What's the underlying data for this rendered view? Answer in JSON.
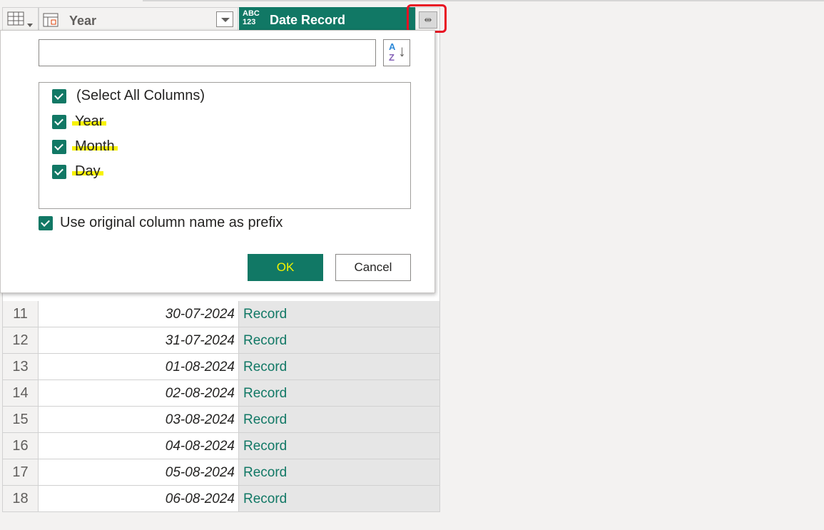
{
  "header": {
    "year_label": "Year",
    "date_type_badge_top": "ABC",
    "date_type_badge_bottom": "123",
    "date_record_label": "Date Record"
  },
  "dialog": {
    "search_value": "",
    "columns": [
      {
        "label": "(Select All Columns)",
        "checked": true
      },
      {
        "label": "Year",
        "checked": true
      },
      {
        "label": "Month",
        "checked": true
      },
      {
        "label": "Day",
        "checked": true
      }
    ],
    "prefix_option": {
      "label": "Use original column name as prefix",
      "checked": true
    },
    "ok_label": "OK",
    "cancel_label": "Cancel"
  },
  "rows": [
    {
      "num": "11",
      "year": "30-07-2024",
      "record": "Record"
    },
    {
      "num": "12",
      "year": "31-07-2024",
      "record": "Record"
    },
    {
      "num": "13",
      "year": "01-08-2024",
      "record": "Record"
    },
    {
      "num": "14",
      "year": "02-08-2024",
      "record": "Record"
    },
    {
      "num": "15",
      "year": "03-08-2024",
      "record": "Record"
    },
    {
      "num": "16",
      "year": "04-08-2024",
      "record": "Record"
    },
    {
      "num": "17",
      "year": "05-08-2024",
      "record": "Record"
    },
    {
      "num": "18",
      "year": "06-08-2024",
      "record": "Record"
    }
  ],
  "colors": {
    "accent": "#117865",
    "highlight": "#f8f300",
    "annotation": "#e81123"
  }
}
